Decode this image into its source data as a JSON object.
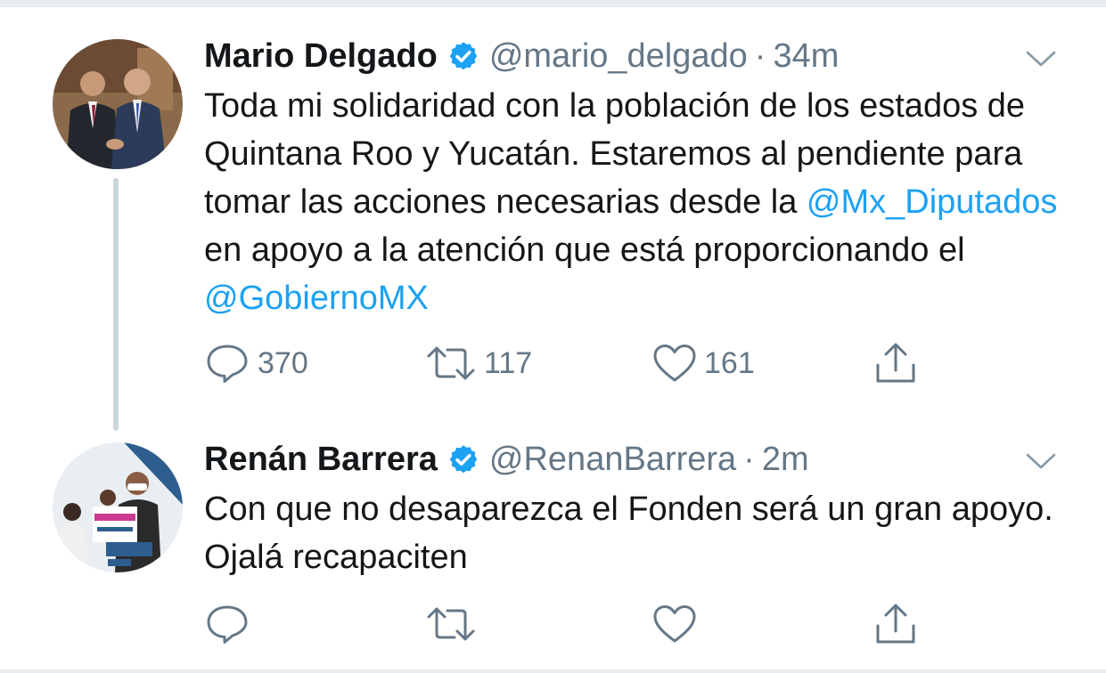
{
  "tweets": [
    {
      "author_name": "Mario Delgado",
      "handle": "@mario_delgado",
      "separator": "·",
      "time": "34m",
      "text_parts": [
        {
          "text": "Toda mi solidaridad con la población de los estados de Quintana Roo y Yucatán. Estaremos al pendiente para tomar las acciones necesarias desde la ",
          "mention": false
        },
        {
          "text": "@Mx_Diputados",
          "mention": true
        },
        {
          "text": " en apoyo a la atención que está proporcionando el ",
          "mention": false
        },
        {
          "text": "@GobiernoMX",
          "mention": true
        }
      ],
      "replies": "370",
      "retweets": "117",
      "likes": "161",
      "verified": true
    },
    {
      "author_name": "Renán Barrera",
      "handle": "@RenanBarrera",
      "separator": "·",
      "time": "2m",
      "text": "Con que no desaparezca el Fonden será un gran apoyo. Ojalá recapaciten",
      "replies": "",
      "retweets": "",
      "likes": "",
      "verified": true
    }
  ],
  "icons": {
    "reply": "reply-icon",
    "retweet": "retweet-icon",
    "like": "like-icon",
    "share": "share-icon",
    "verified": "verified-badge-icon",
    "menu": "chevron-down-icon"
  },
  "colors": {
    "text": "#14171a",
    "secondary": "#657786",
    "mention": "#1da1f2",
    "verified": "#1da1f2",
    "divider": "#e6ecf0",
    "thread_line": "#ccd6dd"
  }
}
